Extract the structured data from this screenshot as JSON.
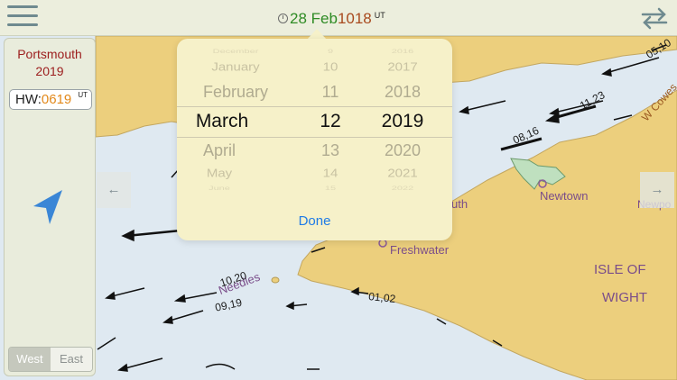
{
  "header": {
    "date": "28 Feb",
    "time": "1018",
    "time_zone": "UT",
    "menu_icon": "hamburger-menu-icon",
    "swap_icon": "swap-arrows-icon",
    "clock_icon": "clock-icon"
  },
  "sidebar": {
    "port_name": "Portsmouth",
    "port_year": "2019",
    "hw_label": "HW:",
    "hw_time": "0619",
    "hw_zone": "UT",
    "location_icon": "location-arrow-icon",
    "direction_toggle": {
      "west": "West",
      "east": "East",
      "selected": "West"
    }
  },
  "date_picker": {
    "months": [
      "December",
      "January",
      "February",
      "March",
      "April",
      "May",
      "June"
    ],
    "days": [
      "9",
      "10",
      "11",
      "12",
      "13",
      "14",
      "15"
    ],
    "years": [
      "2016",
      "2017",
      "2018",
      "2019",
      "2020",
      "2021",
      "2022"
    ],
    "selected_month": "March",
    "selected_day": "12",
    "selected_year": "2019",
    "done_label": "Done"
  },
  "map": {
    "labels": {
      "newtown": "Newtown",
      "freshwater": "Freshwater",
      "yarmouth_fragment": "uth",
      "isle_of": "ISLE OF",
      "wight": "WIGHT",
      "w_cowes": "W Cowes",
      "newport_fragment": "Newpo",
      "needles": "Needles"
    },
    "tide_rates": [
      "05,10",
      "11,23",
      "08,16",
      "10,20",
      "09,19",
      "01,02"
    ],
    "left_arrow_icon": "arrow-left-icon",
    "right_arrow_icon": "arrow-right-icon"
  },
  "colors": {
    "sea": "#dfe9f1",
    "land": "#eccf7d",
    "date": "#2e8b24",
    "time": "#a84a1e",
    "hw_time": "#e2891b",
    "port": "#9c1d1d",
    "link": "#1f7be6"
  }
}
